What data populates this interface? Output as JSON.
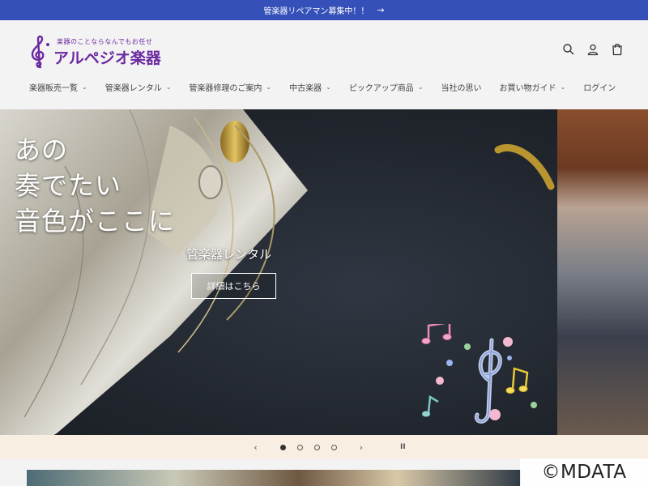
{
  "announcement": {
    "text": "管楽器リペアマン募集中！！",
    "arrow": "→"
  },
  "logo": {
    "tagline": "楽器のことならなんでもお任せ",
    "brand": "アルペジオ楽器",
    "color": "#6b2aa0"
  },
  "header_icons": [
    "search-icon",
    "account-icon",
    "cart-icon"
  ],
  "nav": [
    {
      "label": "楽器販売一覧",
      "has_dropdown": true,
      "chevron": "⌄"
    },
    {
      "label": "管楽器レンタル",
      "has_dropdown": true,
      "chevron": "⌄"
    },
    {
      "label": "管楽器修理のご案内",
      "has_dropdown": true,
      "chevron": "⌄"
    },
    {
      "label": "中古楽器",
      "has_dropdown": true,
      "chevron": "⌄"
    },
    {
      "label": "ピックアップ商品",
      "has_dropdown": true,
      "chevron": "⌄"
    },
    {
      "label": "当社の思い",
      "has_dropdown": false,
      "chevron": ""
    },
    {
      "label": "お買い物ガイド",
      "has_dropdown": true,
      "chevron": "⌄"
    },
    {
      "label": "ログイン",
      "has_dropdown": false,
      "chevron": ""
    }
  ],
  "hero": {
    "headline_lines": [
      "あの",
      "奏でたい",
      "音色がここに"
    ],
    "subheading": "管楽器レンタル",
    "button_label": "詳細はこちら"
  },
  "slider": {
    "prev": "‹",
    "next": "›",
    "pause": "II",
    "slide_count": 4,
    "active_index": 0
  },
  "watermark": "©MDATA",
  "colors": {
    "announcement_bg": "#3550b8",
    "slider_bg": "#f8eee2"
  }
}
